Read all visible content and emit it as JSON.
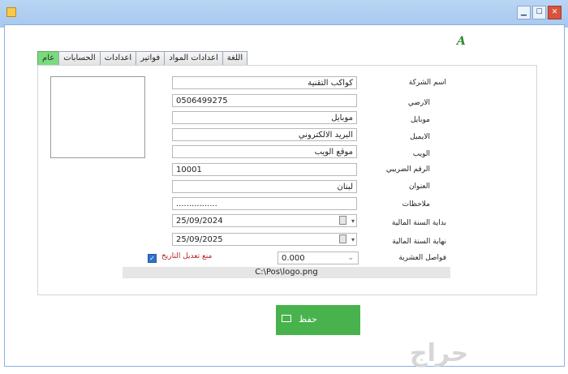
{
  "window": {
    "controls": {
      "minimize": "▁",
      "maximize": "☐",
      "close": "✕"
    }
  },
  "logo_letter": "A",
  "tabs": [
    {
      "label": "عام",
      "active": true
    },
    {
      "label": "الحسابات"
    },
    {
      "label": "اعدادات"
    },
    {
      "label": "فواتير"
    },
    {
      "label": "اعدادات المواد"
    },
    {
      "label": "اللغة"
    }
  ],
  "form": {
    "company_name": {
      "label": "اسم الشركة",
      "value": "كواكب التقنية"
    },
    "landline": {
      "label": "الارضي",
      "value": "0506499275"
    },
    "mobile": {
      "label": "موبايل",
      "value": "موبايل"
    },
    "email": {
      "label": "الايميل",
      "value": "البريد الالكتروني"
    },
    "web": {
      "label": "الويب",
      "value": "موقع الويب"
    },
    "tax_number": {
      "label": "الرقم الضريبي",
      "value": "10001"
    },
    "address": {
      "label": "العنوان",
      "value": "لبنان"
    },
    "notes": {
      "label": "ملاحظات",
      "value": "................"
    },
    "fiscal_start": {
      "label": "بداية السنة المالية",
      "value": "25/09/2024"
    },
    "fiscal_end": {
      "label": "نهاية السنة المالية",
      "value": "25/09/2025"
    },
    "decimals": {
      "label": "فواصل العشرية",
      "value": "0.000"
    },
    "prevent_date_edit": {
      "label": "منع تعديل التاريخ",
      "checked": true
    }
  },
  "logo_path": "C:\\Pos\\logo.png",
  "save_button": {
    "label": "حفظ"
  },
  "watermark": "حراج",
  "colors": {
    "accent_green": "#48b34c",
    "tab_active": "#7bd97e",
    "titlebar": "#b9d5f4"
  }
}
